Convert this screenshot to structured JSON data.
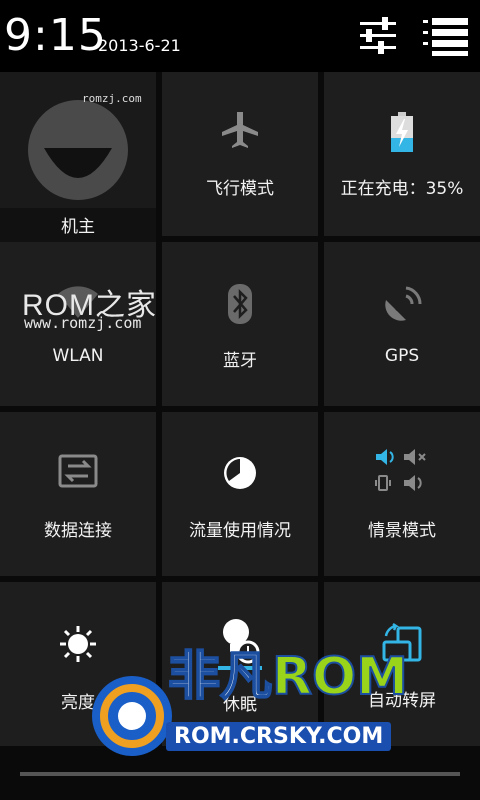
{
  "status_bar": {
    "time": "9:15",
    "date": "2013-6-21",
    "icons": [
      "settings-sliders-icon",
      "notification-list-icon"
    ]
  },
  "watermarks": {
    "top": "romzj.com",
    "brand": "ROM之家",
    "brand_url": "www.romzj.com",
    "bottom_brand": "非凡",
    "bottom_brand_accent": "ROM",
    "bottom_url": "ROM.CRSKY.COM"
  },
  "tiles": {
    "owner": {
      "label": "机主",
      "icon": "avatar-icon"
    },
    "airplane": {
      "label": "飞行模式",
      "icon": "airplane-icon"
    },
    "battery": {
      "label": "正在充电：35%",
      "icon": "battery-charging-icon",
      "level_percent": 35
    },
    "wlan": {
      "label": "WLAN",
      "icon": "wifi-icon"
    },
    "bluetooth": {
      "label": "蓝牙",
      "icon": "bluetooth-icon"
    },
    "gps": {
      "label": "GPS",
      "icon": "gps-satellite-icon"
    },
    "data": {
      "label": "数据连接",
      "icon": "data-transfer-icon"
    },
    "usage": {
      "label": "流量使用情况",
      "icon": "data-usage-icon"
    },
    "profile": {
      "label": "情景模式",
      "icon": "sound-profile-icon"
    },
    "brightness": {
      "label": "亮度",
      "icon": "brightness-icon"
    },
    "sleep": {
      "label": "休眠",
      "icon": "sleep-timeout-icon"
    },
    "rotate": {
      "label": "自动转屏",
      "icon": "auto-rotate-icon"
    }
  },
  "colors": {
    "accent": "#33b5e5",
    "tile_bg": "#1e1e1e",
    "icon_gray": "#8a8a8a"
  }
}
